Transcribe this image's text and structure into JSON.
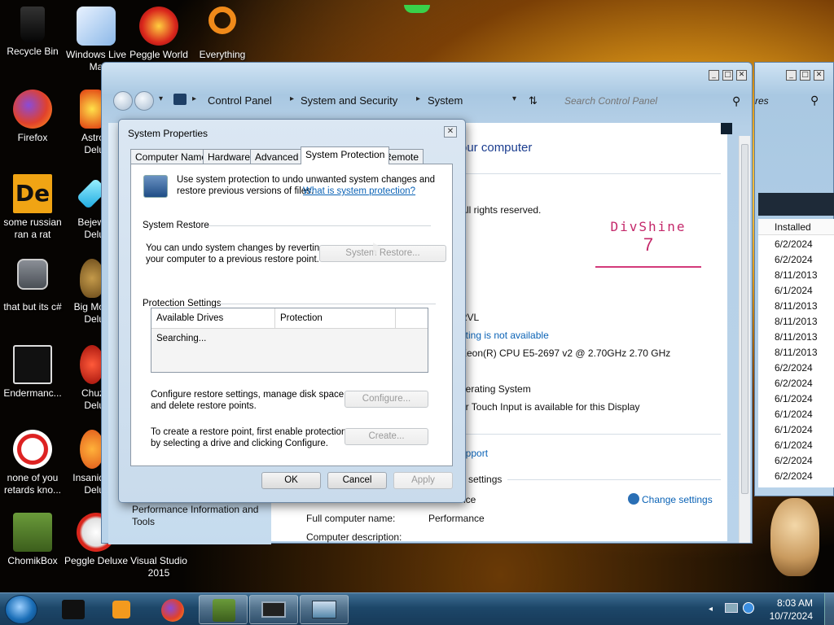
{
  "desktop": {
    "icons": [
      {
        "label": "Recycle Bin"
      },
      {
        "label": "Windows Live Ma"
      },
      {
        "label": "Peggle World"
      },
      {
        "label": "Everything"
      },
      {
        "label": "Firefox"
      },
      {
        "label": "Astro Delu"
      },
      {
        "label": "some russian ran a rat"
      },
      {
        "label": "Bejew Delu"
      },
      {
        "label": "that but its c#"
      },
      {
        "label": "Big Mo Delu"
      },
      {
        "label": "Endermanc..."
      },
      {
        "label": "Chuz Delu"
      },
      {
        "label": "none of you retards kno..."
      },
      {
        "label": "Insaniq Delu"
      },
      {
        "label": "ChomikBox"
      },
      {
        "label": "Peggle Deluxe"
      },
      {
        "label": "Visual Studio 2015"
      }
    ]
  },
  "control_panel": {
    "breadcrumbs": [
      "Control Panel",
      "System and Security",
      "System"
    ],
    "search_placeholder": "Search Control Panel",
    "heading_partial": "our computer",
    "copyright_partial": "All rights reserved.",
    "oem_logo_text": "DivShine",
    "oem_logo_number": "7",
    "computer_name_partial": "RVL",
    "rating_partial": "ating is not available",
    "processor_partial": "Xeon(R) CPU E5-2697 v2 @ 2.70GHz   2.70 GHz",
    "system_type_partial": "perating System",
    "pen_touch_partial": "or Touch Input is available for this Display",
    "support_partial": "upport",
    "settings_section_partial": "p settings",
    "computer_name_row_partial": "nce",
    "change_settings": "Change settings",
    "full_computer_name_label": "Full computer name:",
    "full_computer_name_value": "Performance",
    "computer_description_label": "Computer description:",
    "left_pane_link": "Performance Information and Tools"
  },
  "right_window": {
    "search_partial": "res",
    "column_header": "Installed",
    "dates": [
      "6/2/2024",
      "6/2/2024",
      "8/11/2013",
      "6/1/2024",
      "8/11/2013",
      "8/11/2013",
      "8/11/2013",
      "8/11/2013",
      "6/2/2024",
      "6/2/2024",
      "6/1/2024",
      "6/1/2024",
      "6/1/2024",
      "6/1/2024",
      "6/2/2024",
      "6/2/2024"
    ]
  },
  "system_properties": {
    "title": "System Properties",
    "tabs": [
      "Computer Name",
      "Hardware",
      "Advanced",
      "System Protection",
      "Remote"
    ],
    "active_tab": "System Protection",
    "intro_line1": "Use system protection to undo unwanted system changes and",
    "intro_line2": "restore previous versions of files.",
    "intro_link": "What is system protection?",
    "system_restore_group": "System Restore",
    "restore_text_line1": "You can undo system changes by reverting",
    "restore_text_line2": "your computer to a previous restore point.",
    "system_restore_button": "System Restore...",
    "protection_group": "Protection Settings",
    "col_drives": "Available Drives",
    "col_protection": "Protection",
    "searching": "Searching...",
    "configure_text_line1": "Configure restore settings, manage disk space,",
    "configure_text_line2": "and delete restore points.",
    "configure_button": "Configure...",
    "create_text_line1": "To create a restore point, first enable protection",
    "create_text_line2": "by selecting a drive and clicking Configure.",
    "create_button": "Create...",
    "ok": "OK",
    "cancel": "Cancel",
    "apply": "Apply"
  },
  "taskbar": {
    "time": "8:03 AM",
    "date": "10/7/2024"
  }
}
